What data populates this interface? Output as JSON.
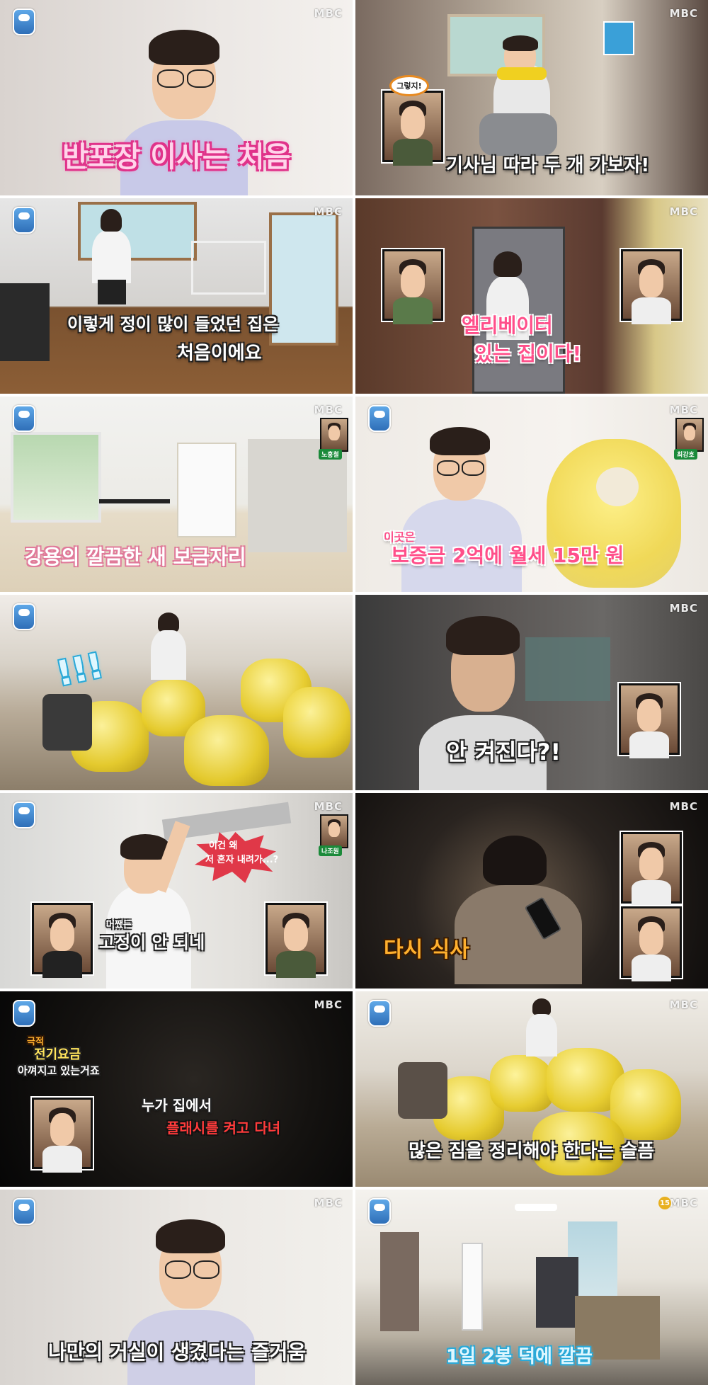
{
  "broadcaster": "MBC",
  "panels": [
    {
      "id": "p01",
      "captions": [
        "반포장 이사는 처음"
      ]
    },
    {
      "id": "p02",
      "captions": [
        "기사님 따라 두 개 가보자!",
        "그렇지!"
      ]
    },
    {
      "id": "p03",
      "captions": [
        "이렇게 정이 많이 들었던 집은",
        "처음이에요"
      ]
    },
    {
      "id": "p04",
      "captions": [
        "엘리베이터",
        "있는 집이다!"
      ]
    },
    {
      "id": "p05",
      "captions": [
        "강용의 깔끔한 새 보금자리"
      ],
      "tag": "노홍철"
    },
    {
      "id": "p06",
      "captions": [
        "이곳은",
        "보증금 2억에 월세 15만 원"
      ],
      "tag": "최강호"
    },
    {
      "id": "p07",
      "captions": [
        "!!!"
      ]
    },
    {
      "id": "p08",
      "captions": [
        "안 켜진다?!"
      ]
    },
    {
      "id": "p09",
      "captions": [
        "이건 왜",
        "저 혼자 내려가...?",
        "어쨌든",
        "고정이 안 되네"
      ],
      "tag": "나조원"
    },
    {
      "id": "p10",
      "captions": [
        "다시 식사"
      ]
    },
    {
      "id": "p11",
      "captions": [
        "극적",
        "전기요금",
        "아껴지고 있는거죠",
        "누가 집에서",
        "플래시를 켜고 다녀"
      ]
    },
    {
      "id": "p12",
      "captions": [
        "많은 짐을 정리해야 한다는 슬픔"
      ]
    },
    {
      "id": "p13",
      "captions": [
        "나만의 거실이 생겼다는 즐거움"
      ]
    },
    {
      "id": "p14",
      "captions": [
        "1일 2봉 덕에 깔끔"
      ],
      "badge": "15"
    }
  ]
}
